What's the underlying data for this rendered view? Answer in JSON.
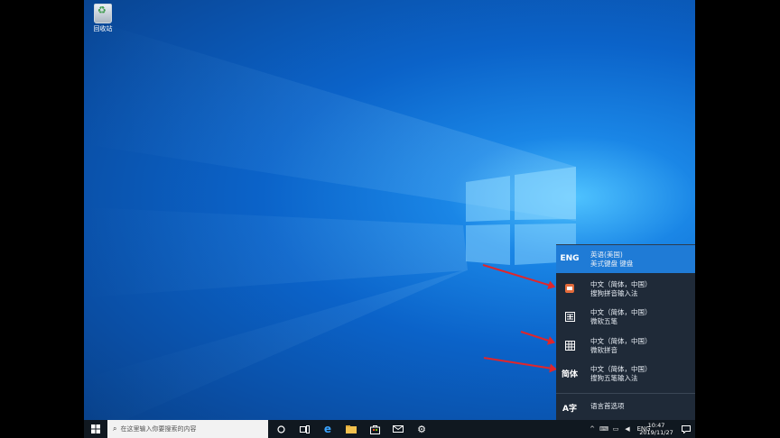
{
  "desktop": {
    "recycle_bin_label": "回收站"
  },
  "language_menu": {
    "items": [
      {
        "icon_text": "ENG",
        "line1": "英语(美国)",
        "line2": "美式键盘 键盘",
        "active": true
      },
      {
        "icon_name": "sogou-pinyin-icon",
        "line1": "中文（简体，中国）",
        "line2": "搜狗拼音输入法"
      },
      {
        "icon_name": "wubi-icon",
        "line1": "中文（简体，中国）",
        "line2": "微软五笔"
      },
      {
        "icon_name": "pinyin-grid-icon",
        "line1": "中文（简体，中国）",
        "line2": "微软拼音"
      },
      {
        "icon_text": "简体",
        "line1": "中文（简体，中国）",
        "line2": "搜狗五笔输入法"
      }
    ],
    "preferences": {
      "icon_text": "A字",
      "label": "语言首选项"
    }
  },
  "taskbar": {
    "search_placeholder": "在这里输入你要搜索的内容",
    "tray_lang": "ENG",
    "time": "10:47",
    "date": "2019/11/27"
  },
  "colors": {
    "accent": "#1f7bd6",
    "arrow": "#e0262b",
    "flyout_bg": "#1f2a38",
    "taskbar_bg": "#101820"
  }
}
